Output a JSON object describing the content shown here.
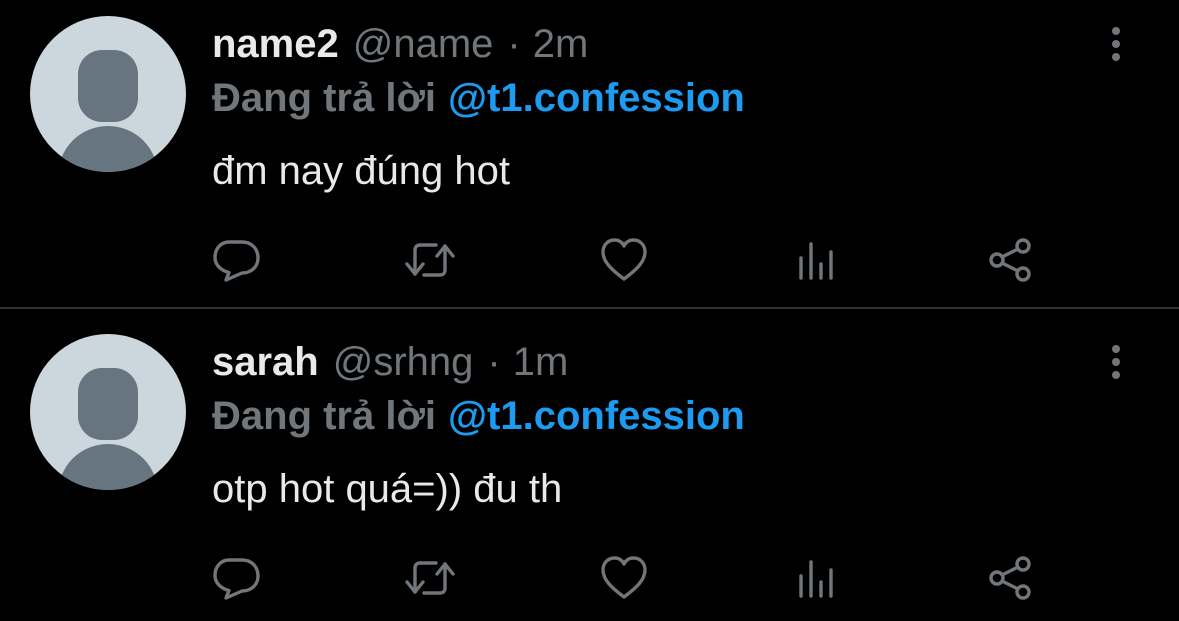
{
  "tweets": [
    {
      "display_name": "name2",
      "handle": "@name",
      "separator": "·",
      "time": "2m",
      "replying_label": "Đang trả lời",
      "replying_to": "@t1.confession",
      "text": "đm nay đúng hot"
    },
    {
      "display_name": "sarah",
      "handle": "@srhng",
      "separator": "·",
      "time": "1m",
      "replying_label": "Đang trả lời",
      "replying_to": "@t1.confession",
      "text": "otp hot quá=)) đu th"
    }
  ],
  "icons": {
    "avatar": "default-avatar",
    "more": "vertical-ellipsis-icon",
    "reply": "reply-bubble-icon",
    "retweet": "retweet-icon",
    "like": "heart-icon",
    "views": "analytics-bars-icon",
    "share": "share-icon"
  },
  "colors": {
    "background": "#000000",
    "primary_text": "#e7e9ea",
    "secondary_text": "#71767b",
    "mention": "#1d9bf0",
    "divider": "#2f3336",
    "avatar_bg": "#ccd6dd",
    "avatar_fg": "#66757f"
  }
}
